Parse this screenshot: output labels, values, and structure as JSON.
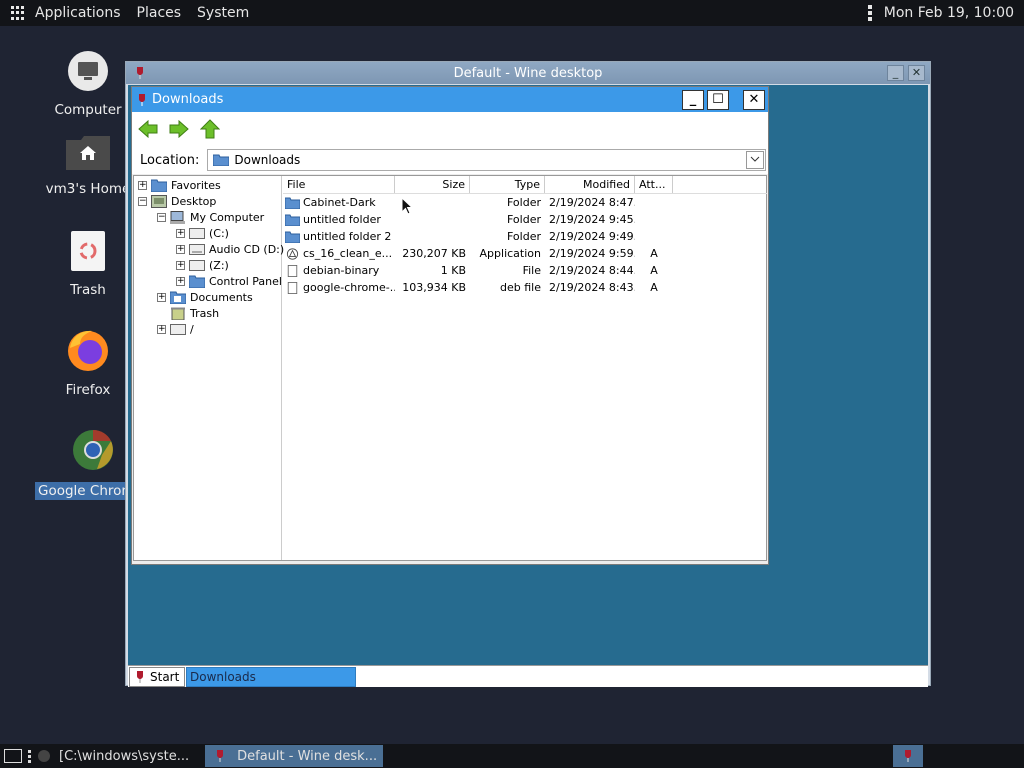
{
  "top_panel": {
    "menus": [
      "Applications",
      "Places",
      "System"
    ],
    "clock": "Mon Feb 19, 10:00"
  },
  "desktop_icons": {
    "computer": "Computer",
    "home": "vm3's Home",
    "trash": "Trash",
    "firefox": "Firefox",
    "chrome": "Google Chrome"
  },
  "wine_window": {
    "title": "Default - Wine desktop"
  },
  "downloads_window": {
    "title": "Downloads",
    "location_label": "Location:",
    "location_value": "Downloads",
    "tree": {
      "favorites": "Favorites",
      "desktop": "Desktop",
      "my_computer": "My Computer",
      "drive_c": "(C:)",
      "audio_cd": "Audio CD (D:)",
      "drive_z": "(Z:)",
      "control_panel": "Control Panel",
      "documents": "Documents",
      "trash": "Trash",
      "root": "/"
    },
    "columns": {
      "file": "File",
      "size": "Size",
      "type": "Type",
      "modified": "Modified",
      "attributes": "Att..."
    },
    "files": [
      {
        "name": "Cabinet-Dark",
        "size": "",
        "type": "Folder",
        "modified": "2/19/2024 8:47...",
        "att": ""
      },
      {
        "name": "untitled folder",
        "size": "",
        "type": "Folder",
        "modified": "2/19/2024 9:45...",
        "att": ""
      },
      {
        "name": "untitled folder 2",
        "size": "",
        "type": "Folder",
        "modified": "2/19/2024 9:49...",
        "att": ""
      },
      {
        "name": "cs_16_clean_e...",
        "size": "230,207 KB",
        "type": "Application",
        "modified": "2/19/2024 9:59...",
        "att": "A"
      },
      {
        "name": "debian-binary",
        "size": "1 KB",
        "type": "File",
        "modified": "2/19/2024 8:44...",
        "att": "A"
      },
      {
        "name": "google-chrome-...",
        "size": "103,934 KB",
        "type": "deb file",
        "modified": "2/19/2024 8:43...",
        "att": "A"
      }
    ]
  },
  "wine_taskbar": {
    "start": "Start",
    "task": "Downloads"
  },
  "bottom_panel": {
    "task1": "[C:\\windows\\syste...",
    "task2": "Default - Wine desk..."
  }
}
